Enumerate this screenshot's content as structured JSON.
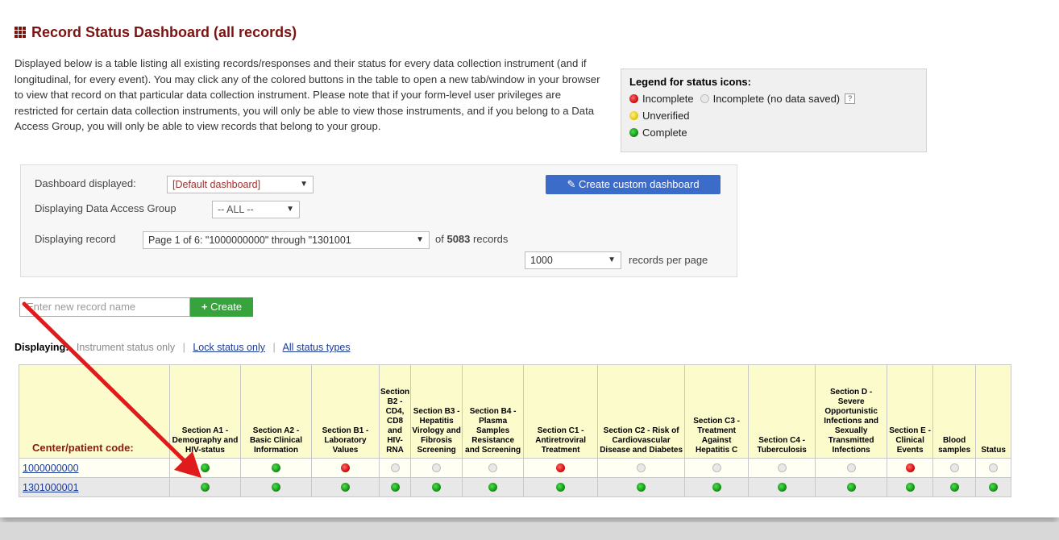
{
  "title": "Record Status Dashboard (all records)",
  "description": "Displayed below is a table listing all existing records/responses and their status for every data collection instrument (and if longitudinal, for every event). You may click any of the colored buttons in the table to open a new tab/window in your browser to view that record on that particular data collection instrument. Please note that if your form-level user privileges are restricted for certain data collection instruments, you will only be able to view those instruments, and if you belong to a Data Access Group, you will only be able to view records that belong to your group.",
  "legend": {
    "title": "Legend for status icons:",
    "incomplete": "Incomplete",
    "incomplete_nodata": "Incomplete (no data saved)",
    "help": "?",
    "unverified": "Unverified",
    "complete": "Complete"
  },
  "controls": {
    "dashboard_label": "Dashboard displayed:",
    "dashboard_value": "[Default dashboard]",
    "create_custom": "Create custom dashboard",
    "dag_label": "Displaying Data Access Group",
    "dag_value": "-- ALL --",
    "record_label": "Displaying record",
    "record_value": "Page 1 of 6: \"1000000000\" through \"1301001",
    "records_of": "of",
    "records_count": "5083",
    "records_word": "records",
    "per_page_value": "1000",
    "per_page_label": "records per page"
  },
  "new_record": {
    "placeholder": "Enter new record name",
    "create_label": "Create"
  },
  "displaying": {
    "label": "Displaying:",
    "current": "Instrument status only",
    "lock_link": "Lock status only",
    "all_link": "All status types"
  },
  "table": {
    "code_header": "Center/patient code:",
    "columns": [
      "Section A1 - Demography and HIV-status",
      "Section A2 - Basic Clinical Information",
      "Section B1 - Laboratory Values",
      "Section B2 - CD4, CD8 and HIV-RNA",
      "Section B3 - Hepatitis Virology and Fibrosis Screening",
      "Section B4 - Plasma Samples Resistance and Screening",
      "Section C1 - Antiretroviral Treatment",
      "Section C2 - Risk of Cardiovascular Disease and Diabetes",
      "Section C3 - Treatment Against Hepatitis C",
      "Section C4 - Tuberculosis",
      "Section D - Severe Opportunistic Infections and Sexually Transmitted Infections",
      "Section E - Clinical Events",
      "Blood samples",
      "Status"
    ],
    "rows": [
      {
        "id": "1000000000",
        "statuses": [
          "complete",
          "complete",
          "incomplete",
          "nodata",
          "nodata",
          "nodata",
          "incomplete",
          "nodata",
          "nodata",
          "nodata",
          "nodata",
          "incomplete",
          "nodata",
          "nodata"
        ]
      },
      {
        "id": "1301000001",
        "statuses": [
          "complete",
          "complete",
          "complete",
          "complete",
          "complete",
          "complete",
          "complete",
          "complete",
          "complete",
          "complete",
          "complete",
          "complete",
          "complete",
          "complete"
        ]
      }
    ]
  },
  "colors": {
    "title": "#7a1411",
    "header_bg": "#fcfbcc",
    "create_btn": "#36a33c",
    "custom_btn": "#3b6cc9",
    "arrow": "#e01b1b"
  }
}
